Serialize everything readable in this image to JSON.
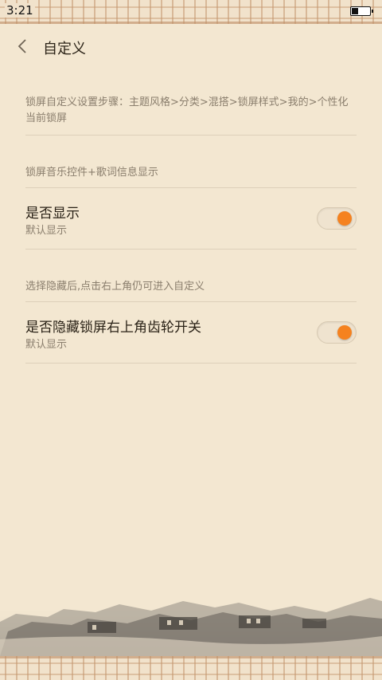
{
  "status_bar": {
    "time": "3:21",
    "battery_level": 0.35
  },
  "header": {
    "title": "自定义",
    "back_icon": "chevron-left-icon"
  },
  "settings": {
    "intro_text": "锁屏自定义设置步骤：主题风格>分类>混搭>锁屏样式>我的>个性化当前锁屏",
    "section1_caption": "锁屏音乐控件+歌词信息显示",
    "row1": {
      "title": "是否显示",
      "subtitle": "默认显示",
      "toggle_on": true
    },
    "section2_caption": "选择隐藏后,点击右上角仍可进入自定义",
    "row2": {
      "title": "是否隐藏锁屏右上角齿轮开关",
      "subtitle": "默认显示",
      "toggle_on": true
    }
  },
  "colors": {
    "background": "#f3e7d1",
    "toggle_accent": "#f5821f"
  }
}
